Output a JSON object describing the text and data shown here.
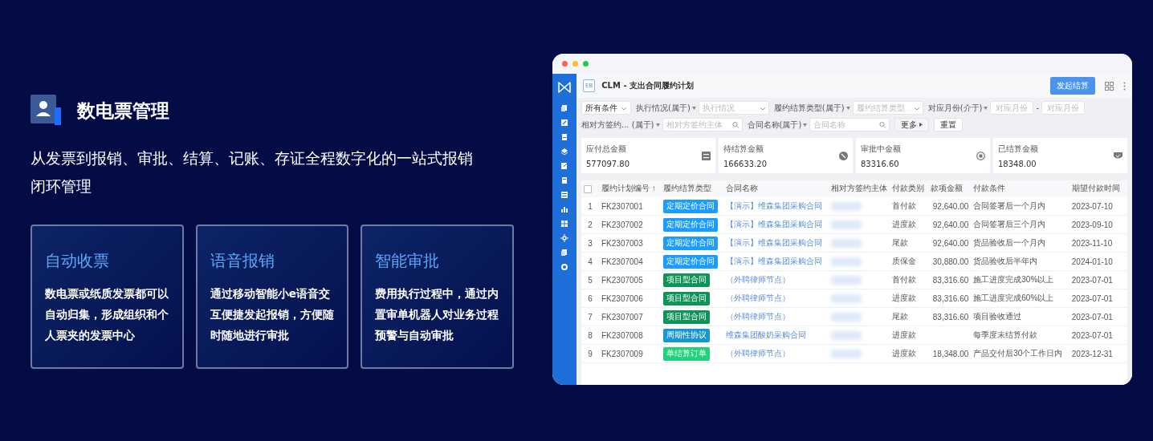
{
  "feature": {
    "title": "数电票管理",
    "description": "从发票到报销、审批、结算、记账、存证全程数字化的一站式报销闭环管理"
  },
  "cards": [
    {
      "title": "自动收票",
      "body": "数电票或纸质发票都可以自动归集，形成组织和个人票夹的发票中心"
    },
    {
      "title": "语音报销",
      "body": "通过移动智能小e语音交互便捷发起报销，方便随时随地进行审批"
    },
    {
      "title": "智能审批",
      "body": "费用执行过程中，通过内置审单机器人对业务过程预警与自动审批"
    }
  ],
  "app": {
    "badge": "EB",
    "page_title": "CLM - 支出合同履约计划",
    "primary_button": "发起结算",
    "filter_rows": [
      [
        {
          "kind": "dropdown",
          "value": "所有条件"
        },
        {
          "kind": "select",
          "label": "执行情况(属于)",
          "placeholder": "执行情况"
        },
        {
          "kind": "select",
          "label": "履约结算类型(属于)",
          "placeholder": "履约结算类型"
        },
        {
          "kind": "range",
          "label": "对应月份(介于)",
          "placeholder": "对应月份",
          "separator": "-",
          "placeholder_end": "对应月份"
        }
      ],
      [
        {
          "kind": "search",
          "label": "相对方签约... (属于)",
          "placeholder": "相对方签约主体"
        },
        {
          "kind": "search",
          "label": "合同名称(属于)",
          "placeholder": "合同名称"
        },
        {
          "kind": "more",
          "value": "更多"
        },
        {
          "kind": "button",
          "value": "重置"
        }
      ]
    ],
    "summary_cards": [
      {
        "label": "应付总金额",
        "value": "577097.80"
      },
      {
        "label": "待结算金额",
        "value": "166633.20"
      },
      {
        "label": "审批中金额",
        "value": "83316.60"
      },
      {
        "label": "已结算金额",
        "value": "18348.00"
      }
    ],
    "table": {
      "select_all": {
        "checked": false
      },
      "columns": [
        {
          "label": "履约计划编号",
          "sort": "↑"
        },
        {
          "label": "履约结算类型"
        },
        {
          "label": "合同名称"
        },
        {
          "label": "相对方签约主体"
        },
        {
          "label": "付款类别"
        },
        {
          "label": "款项金额"
        },
        {
          "label": "付款条件"
        },
        {
          "label": "期望付款时间"
        }
      ],
      "rows": [
        {
          "index": "1",
          "id": "FK2307001",
          "type": {
            "label": "定期定价合同",
            "color": "#1b9cff"
          },
          "contract": "【演示】维森集团采购合同",
          "category": "首付款",
          "amount": "92,640.00",
          "condition": "合同签署后一个月内",
          "date": "2023-07-10"
        },
        {
          "index": "2",
          "id": "FK2307002",
          "type": {
            "label": "定期定价合同",
            "color": "#1b9cff"
          },
          "contract": "【演示】维森集团采购合同",
          "category": "进度款",
          "amount": "92,640.00",
          "condition": "合同签署后三个月内",
          "date": "2023-09-10"
        },
        {
          "index": "3",
          "id": "FK2307003",
          "type": {
            "label": "定期定价合同",
            "color": "#1b9cff"
          },
          "contract": "【演示】维森集团采购合同",
          "category": "尾款",
          "amount": "92,640.00",
          "condition": "货品验收后一个月内",
          "date": "2023-11-10"
        },
        {
          "index": "4",
          "id": "FK2307004",
          "type": {
            "label": "定期定价合同",
            "color": "#1b9cff"
          },
          "contract": "【演示】维森集团采购合同",
          "category": "质保金",
          "amount": "30,880.00",
          "condition": "货品验收后半年内",
          "date": "2024-01-10"
        },
        {
          "index": "5",
          "id": "FK2307005",
          "type": {
            "label": "项目型合同",
            "color": "#0f9458"
          },
          "contract": "（外聘律师节点）",
          "category": "首付款",
          "amount": "83,316.60",
          "condition": "施工进度完成30%以上",
          "date": "2023-07-01"
        },
        {
          "index": "6",
          "id": "FK2307006",
          "type": {
            "label": "项目型合同",
            "color": "#0f9458"
          },
          "contract": "（外聘律师节点）",
          "category": "进度款",
          "amount": "83,316.60",
          "condition": "施工进度完成60%以上",
          "date": "2023-07-01"
        },
        {
          "index": "7",
          "id": "FK2307007",
          "type": {
            "label": "项目型合同",
            "color": "#0f9458"
          },
          "contract": "（外聘律师节点）",
          "category": "尾款",
          "amount": "83,316.60",
          "condition": "项目验收通过",
          "date": "2023-07-01"
        },
        {
          "index": "8",
          "id": "FK2307008",
          "type": {
            "label": "周期性协议",
            "color": "#1697d0"
          },
          "contract": "维森集团酸奶采购合同",
          "category": "进度款",
          "condition": "每季度末结算付款",
          "date": "2023-07-01"
        },
        {
          "index": "9",
          "id": "FK2307009",
          "type": {
            "label": "单结算订单",
            "color": "#20d27a"
          },
          "contract": "（外聘律师节点）",
          "category": "进度款",
          "amount": "18,348.00",
          "condition": "产品交付后30个工作日内",
          "date": "2023-12-31"
        }
      ]
    }
  }
}
